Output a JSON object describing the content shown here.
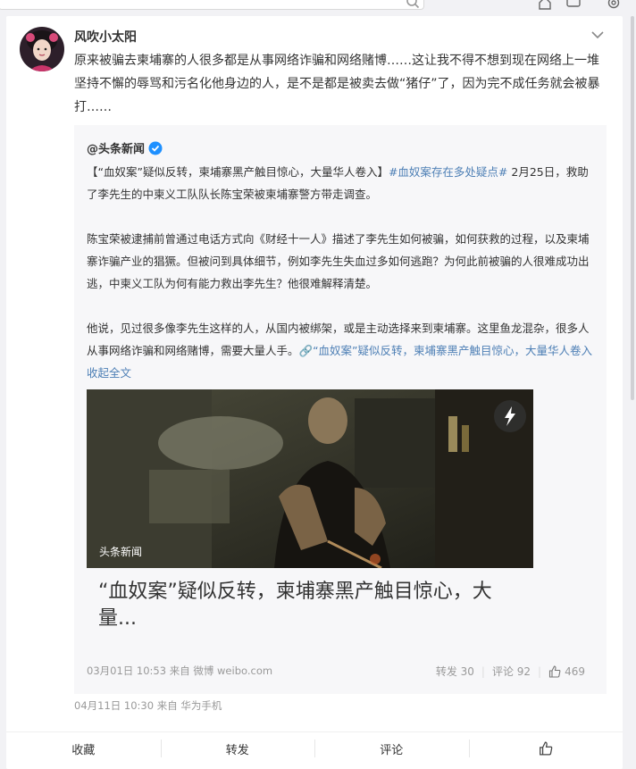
{
  "post": {
    "author": "风吹小太阳",
    "text": "原来被骗去柬埔寨的人很多都是从事网络诈骗和网络赌博……这让我不得不想到现在网络上一堆坚持不懈的辱骂和污名化他身边的人，是不是都是被卖去做“猪仔”了，因为完不成任务就会被暴打……",
    "meta": "04月11日 10:30  来自 华为手机"
  },
  "repost": {
    "author": "@头条新闻",
    "para1_lead": "【“血奴案”疑似反转，柬埔寨黑产触目惊心，大量华人卷入】",
    "para1_tag": "#血奴案存在多处疑点#",
    "para1_rest": " 2月25日，救助了李先生的中柬义工队队长陈宝荣被柬埔寨警方带走调查。",
    "para2": "陈宝荣被逮捕前曾通过电话方式向《财经十一人》描述了李先生如何被骗，如何获救的过程，以及柬埔寨诈骗产业的猖獗。但被问到具体细节，例如李先生失血过多如何逃跑？为何此前被骗的人很难成功出逃，中柬义工队为何有能力救出李先生？他很难解释清楚。",
    "para3": "他说，见过很多像李先生这样的人，从国内被绑架，或是主动选择来到柬埔寨。这里鱼龙混杂，很多人从事网络诈骗和网络赌博，需要大量人手。",
    "para3_link": "🔗“血奴案”疑似反转，柬埔寨黑产触目惊心，大量华人卷入",
    "collapse": "收起全文",
    "collapse_arrow": "^",
    "video_source": "头条新闻",
    "video_title": "“血奴案”疑似反转，柬埔寨黑产触目惊心，大量...",
    "meta": "03月01日 10:53  来自 微博 weibo.com",
    "repost_label": "转发 30",
    "comment_label": "评论 92",
    "like_count": "469"
  },
  "actions": {
    "favorite": "收藏",
    "repost": "转发",
    "comment": "评论"
  },
  "colors": {
    "link": "#4d7fb5",
    "verified": "#1e90ff",
    "background": "#f2f2f5"
  }
}
